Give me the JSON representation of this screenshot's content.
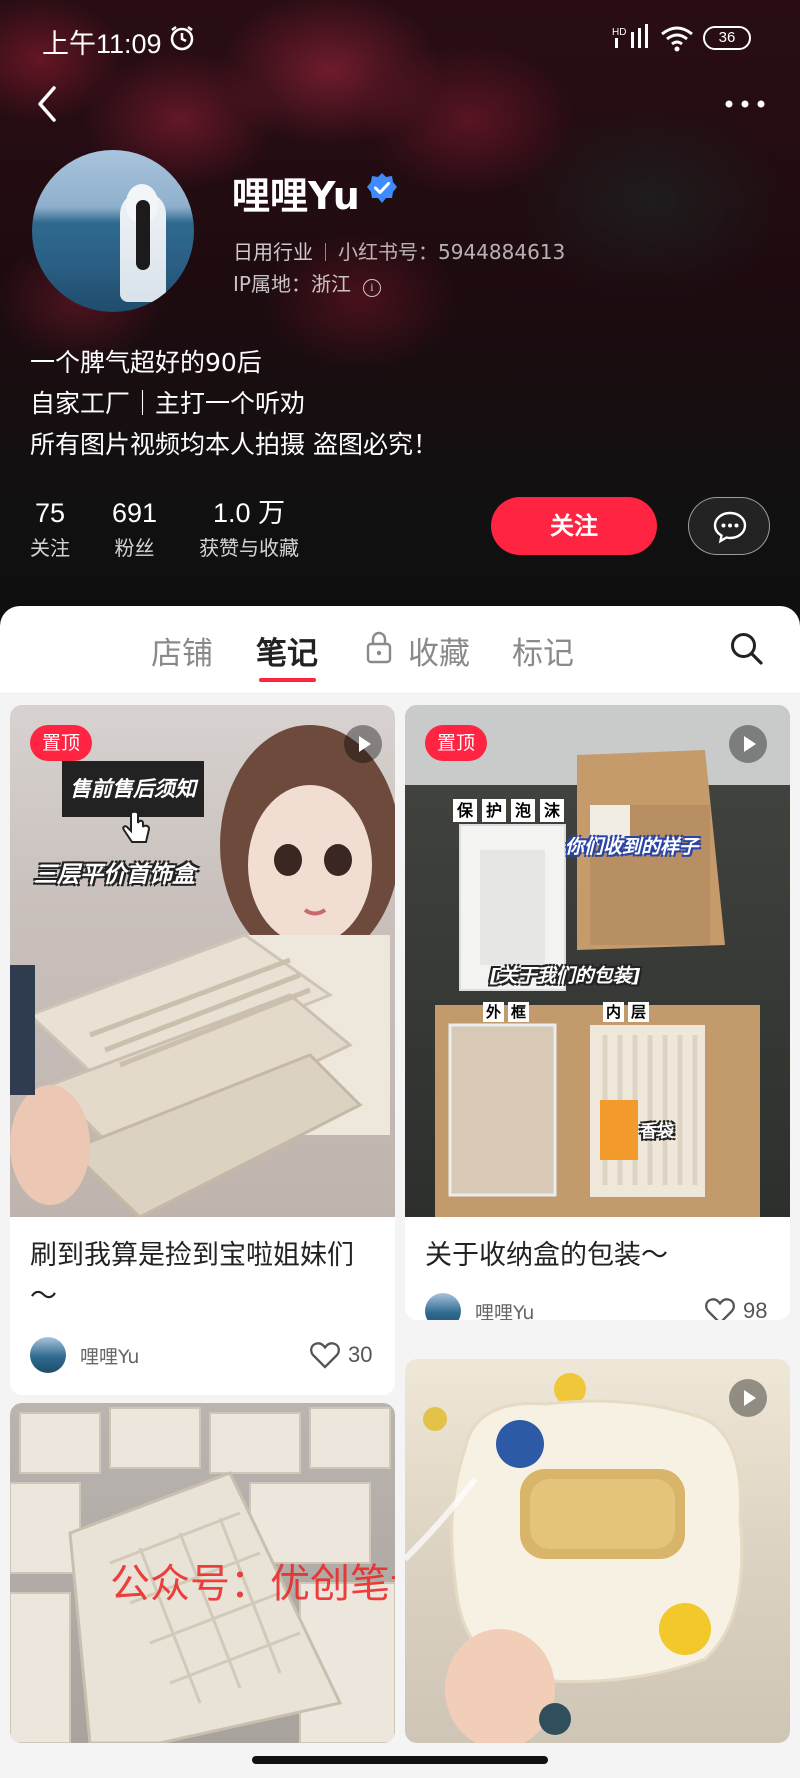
{
  "status_bar": {
    "time": "上午11:09",
    "battery": "36",
    "network": "HD"
  },
  "profile": {
    "nickname": "哩哩Yu",
    "industry": "日用行业",
    "redbook_id_label": "小红书号：",
    "redbook_id": "5944884613",
    "ip_label": "IP属地：",
    "ip_location": "浙江",
    "bio": [
      "一个脾气超好的90后",
      "自家工厂｜主打一个听劝",
      "所有图片视频均本人拍摄 盗图必究！"
    ],
    "stats": [
      {
        "num": "75",
        "label": "关注"
      },
      {
        "num": "691",
        "label": "粉丝"
      },
      {
        "num": "1.0 万",
        "label": "获赞与收藏"
      }
    ],
    "follow_label": "关注"
  },
  "tabs": [
    {
      "label": "店铺",
      "active": false
    },
    {
      "label": "笔记",
      "active": true
    },
    {
      "label": "收藏",
      "active": false,
      "locked": true
    },
    {
      "label": "标记",
      "active": false
    }
  ],
  "notes": [
    {
      "pinned_label": "置顶",
      "is_video": true,
      "overlay_texts": [
        "售前售后须知",
        "三层平价首饰盒"
      ],
      "title": "刷到我算是捡到宝啦姐妹们～",
      "author": "哩哩Yu",
      "likes": "30"
    },
    {
      "pinned_label": "置顶",
      "is_video": true,
      "overlay_texts": [
        "保",
        "护",
        "泡",
        "沫",
        "你们收到的样子",
        "[关于我们的包装]",
        "外",
        "框",
        "内",
        "层",
        "香袋"
      ],
      "title": "关于收纳盒的包装～",
      "author": "哩哩Yu",
      "likes": "98"
    },
    {
      "is_video": false,
      "overlay_texts": [
        "公众号：优创笔记"
      ]
    },
    {
      "is_video": true,
      "overlay_texts": []
    }
  ],
  "colors": {
    "accent": "#ff2442",
    "header_bg": "#1a0c10"
  }
}
